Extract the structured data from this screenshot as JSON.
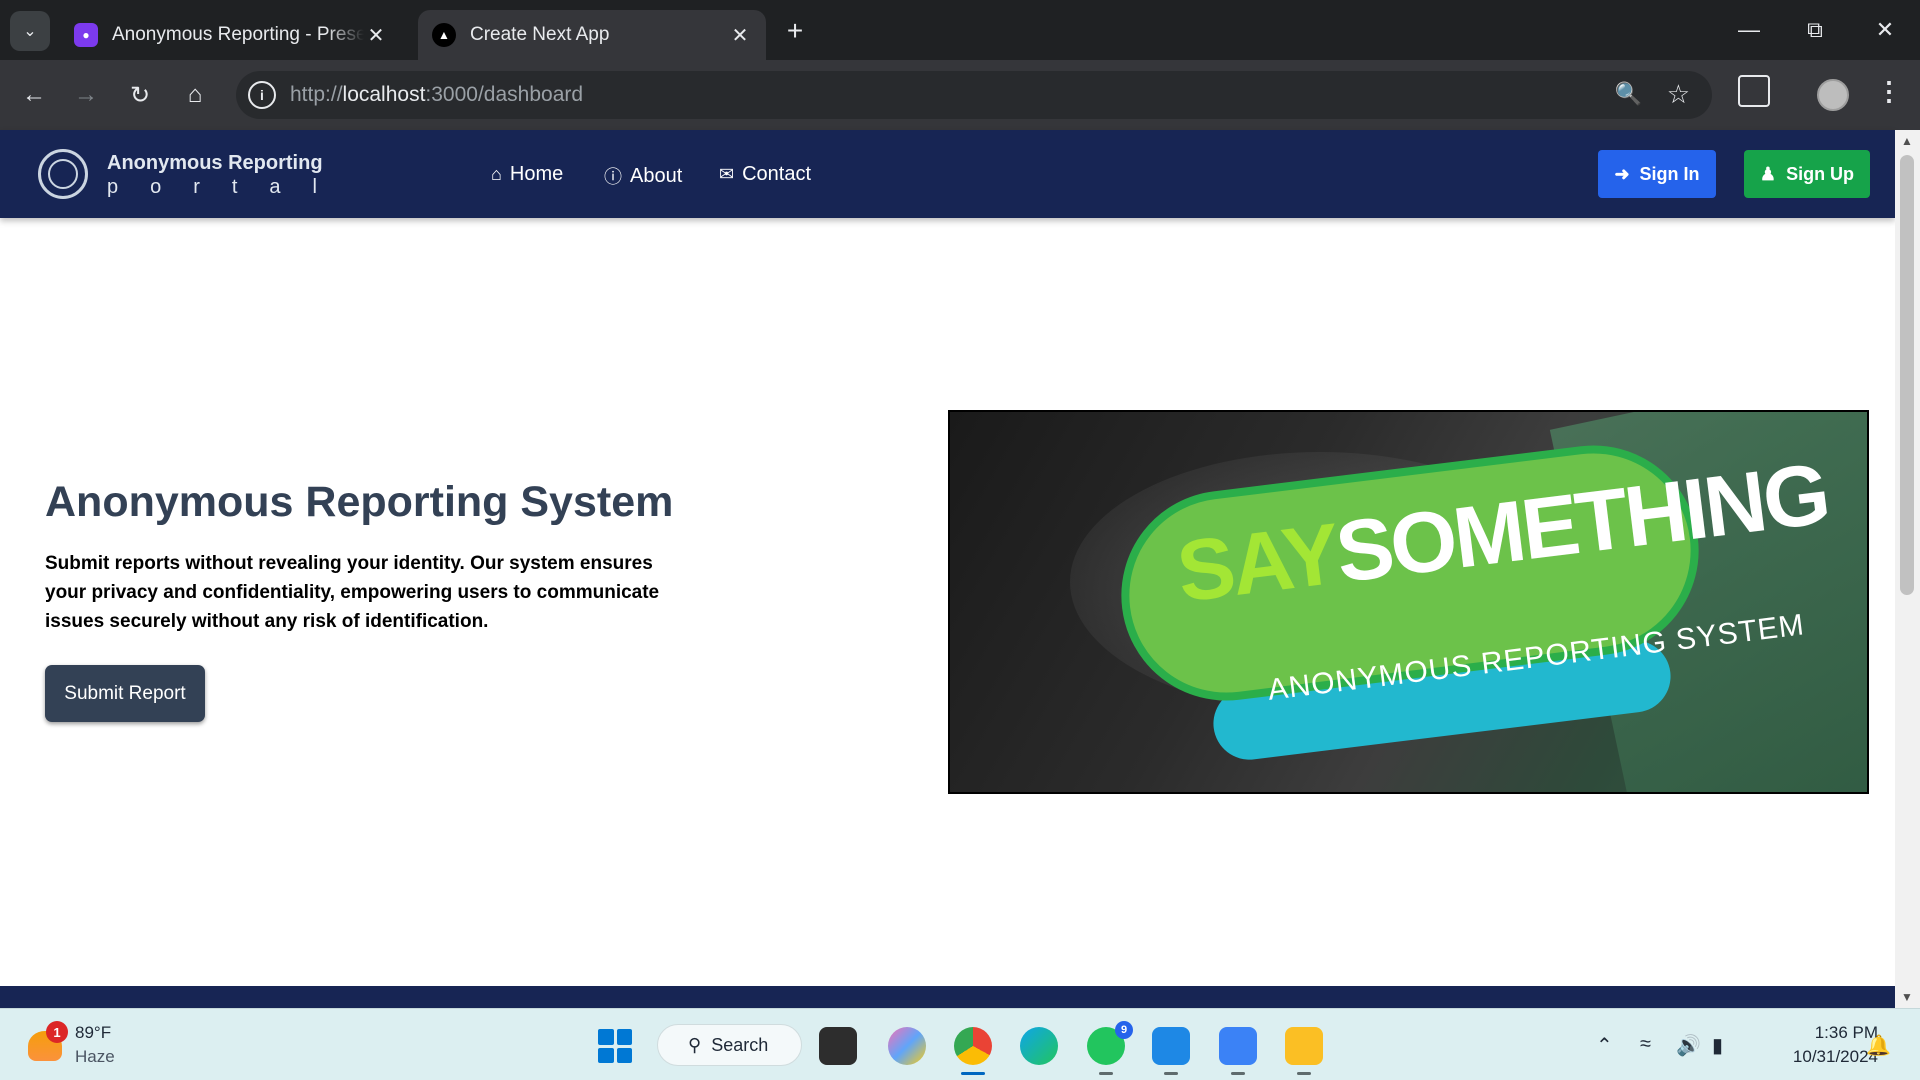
{
  "browser": {
    "tabs": [
      {
        "title": "Anonymous Reporting - Presen",
        "active": false,
        "favicon": "app-icon"
      },
      {
        "title": "Create Next App",
        "active": true,
        "favicon": "nextjs-icon"
      }
    ],
    "url_prefix": "http://",
    "url_host": "localhost",
    "url_rest": ":3000/dashboard"
  },
  "navbar": {
    "brand_name": "Anonymous Reporting",
    "brand_sub": [
      "p",
      "o",
      "r",
      "t",
      "a",
      "l"
    ],
    "links": [
      {
        "label": "Home",
        "icon": "home-icon"
      },
      {
        "label": "About",
        "icon": "info-icon"
      },
      {
        "label": "Contact",
        "icon": "envelope-icon"
      }
    ],
    "signin_label": "Sign In",
    "signup_label": "Sign Up",
    "colors": {
      "navbar_bg": "#172554",
      "signin_bg": "#2563eb",
      "signup_bg": "#16a34a"
    }
  },
  "hero": {
    "title": "Anonymous Reporting System",
    "description": "Submit reports without revealing your identity. Our system ensures your privacy and confidentiality, empowering users to communicate issues securely without any risk of identification.",
    "button_label": "Submit Report",
    "image": {
      "say": "SAY",
      "something": "SOMETHING",
      "subtitle": "ANONYMOUS REPORTING SYSTEM"
    }
  },
  "taskbar": {
    "weather_temp": "89°F",
    "weather_desc": "Haze",
    "weather_badge": "1",
    "search_label": "Search",
    "whatsapp_badge": "9",
    "time": "1:36 PM",
    "date": "10/31/2024"
  }
}
